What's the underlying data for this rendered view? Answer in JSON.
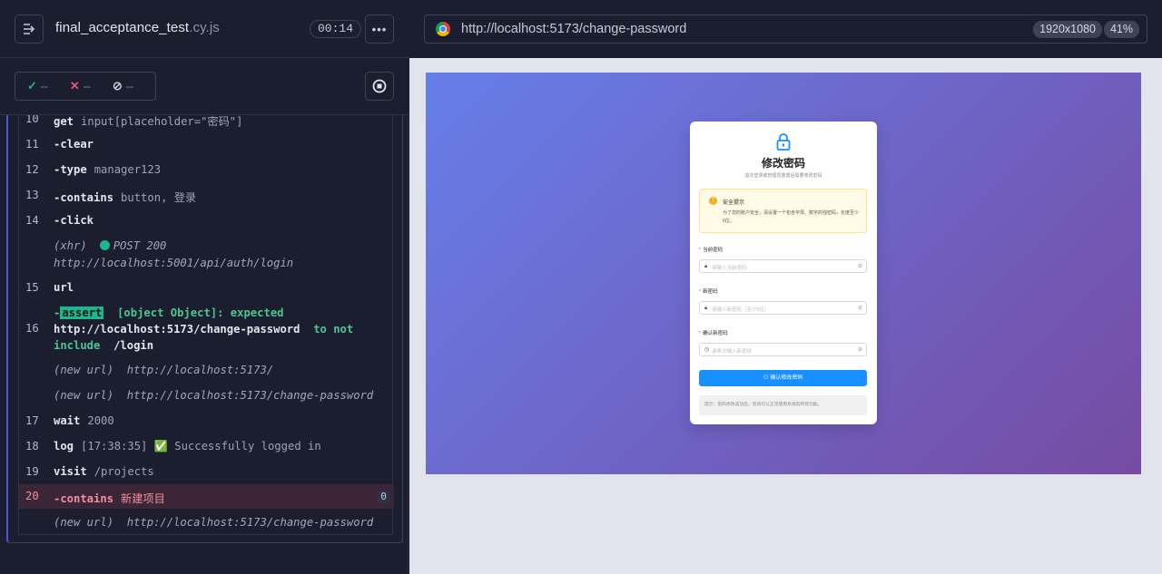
{
  "reporter": {
    "spec_name": "final_acceptance_test",
    "spec_ext": ".cy.js",
    "timer": "00:14",
    "stats": {
      "passed": "--",
      "failed": "--",
      "pending": "--"
    },
    "commands": [
      {
        "num": "10",
        "name": "get",
        "message": "input[placeholder=\"密码\"]"
      },
      {
        "num": "11",
        "name": "-clear",
        "message": ""
      },
      {
        "num": "12",
        "name": "-type",
        "message": "manager123"
      },
      {
        "num": "13",
        "name": "-contains",
        "message": "button, 登录"
      },
      {
        "num": "14",
        "name": "-click",
        "message": ""
      },
      {
        "num": "15",
        "name": "url",
        "message": ""
      },
      {
        "num": "16",
        "name": "-",
        "message": ""
      },
      {
        "num": "17",
        "name": "wait",
        "message": "2000"
      },
      {
        "num": "18",
        "name": "log",
        "message": "[17:38:35] ✅ Successfully logged in"
      },
      {
        "num": "19",
        "name": "visit",
        "message": "/projects"
      },
      {
        "num": "20",
        "name": "-contains",
        "message": "新建项目"
      }
    ],
    "xhr": {
      "label": "(xhr)",
      "method_status": "POST 200",
      "url": "http://localhost:5001/api/auth/login"
    },
    "assert": {
      "badge": "assert",
      "text1": "[object Object]: expected",
      "value": "http://localhost:5173/change-password",
      "text2": "to not",
      "text3": "include",
      "expected": "/login"
    },
    "newurl_1": {
      "label": "(new url)",
      "url": "http://localhost:5173/"
    },
    "newurl_2": {
      "label": "(new url)",
      "url": "http://localhost:5173/change-password"
    },
    "newurl_3": {
      "label": "(new url)",
      "url": "http://localhost:5173/change-password"
    },
    "fail_count": "0"
  },
  "browser": {
    "url": "http://localhost:5173/change-password",
    "viewport": "1920x1080",
    "zoom": "41%"
  },
  "app": {
    "title": "修改密码",
    "subtitle": "首次登录或管理员重置后需要修改密码",
    "alert_title": "安全提示",
    "alert_desc": "为了您的账户安全，请设置一个包含字母、数字的强密码，长度至少6位。",
    "field_current_label": "当前密码",
    "field_current_placeholder": "请输入当前密码",
    "field_new_label": "新密码",
    "field_new_placeholder": "请输入新密码（至少6位）",
    "field_confirm_label": "确认新密码",
    "field_confirm_placeholder": "请再次输入新密码",
    "submit_label": "确认修改密码",
    "hint": "提示：密码修改成功后，您将可以正常使用系统的所有功能。",
    "colors": {
      "gradient_start": "#667eea",
      "gradient_end": "#764ba2",
      "primary": "#1890ff"
    }
  }
}
